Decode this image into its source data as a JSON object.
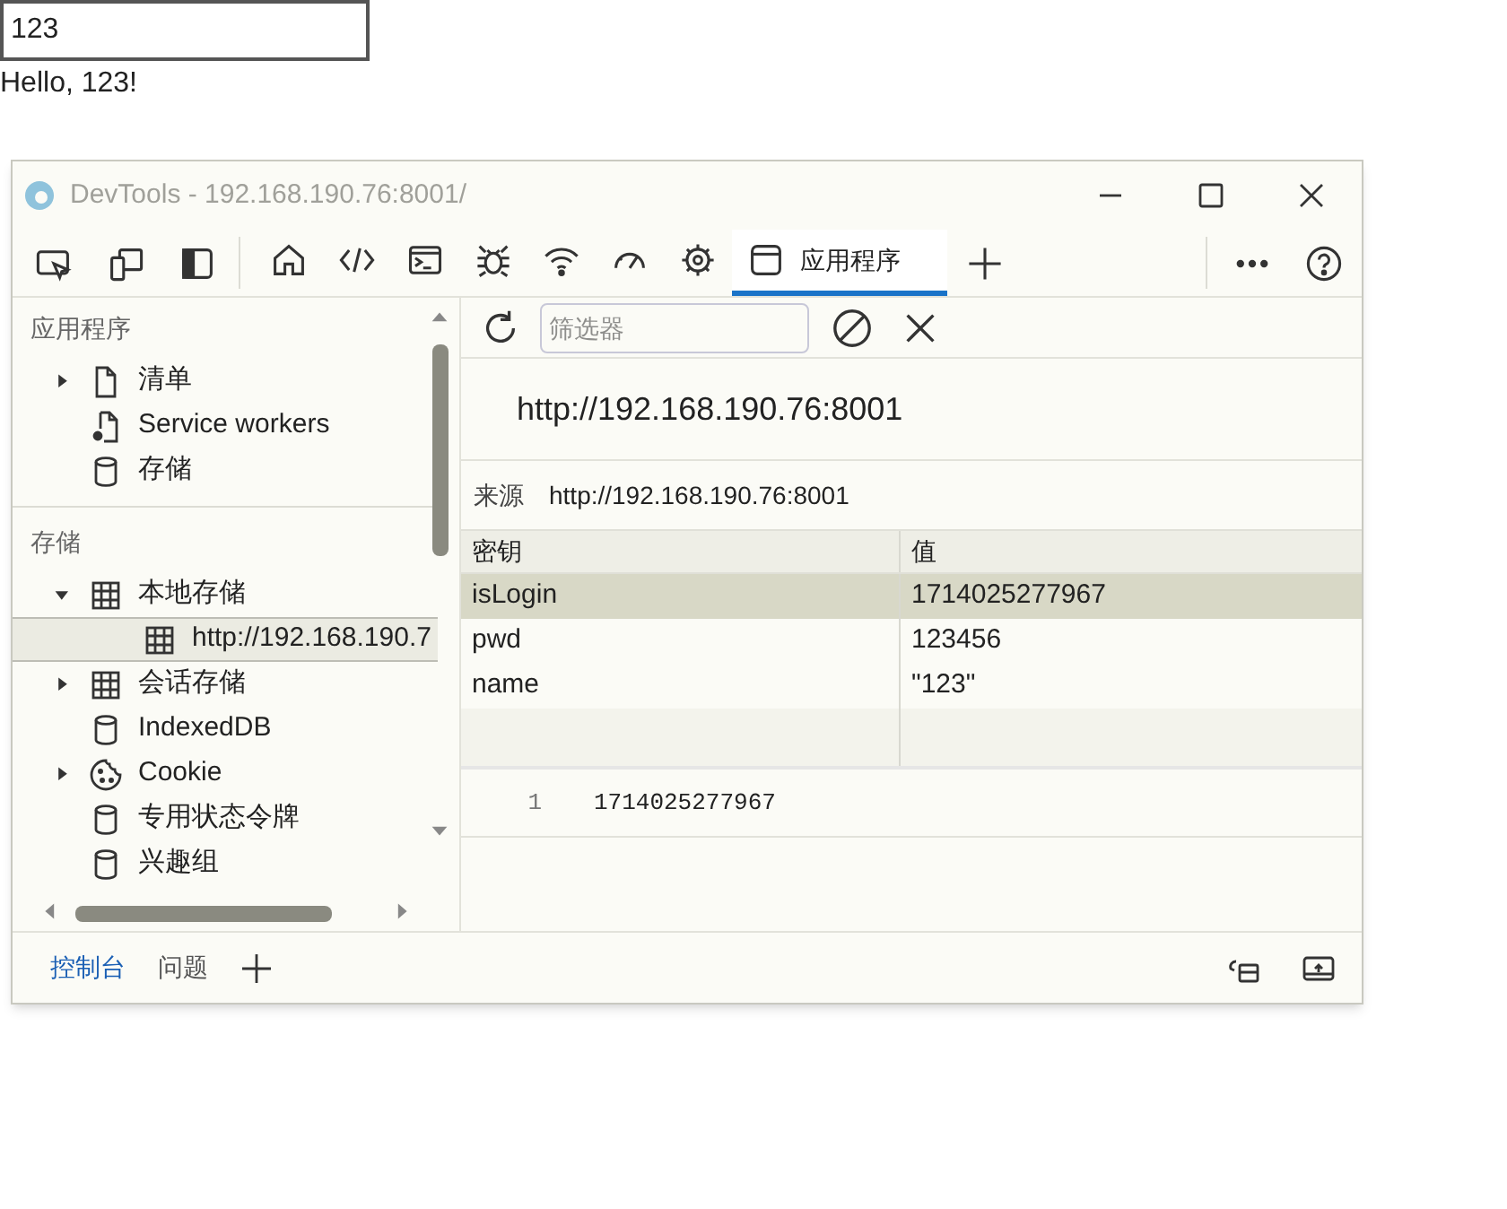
{
  "page": {
    "input_value": "123",
    "greeting": "Hello, 123!"
  },
  "window": {
    "title": "DevTools - 192.168.190.76:8001/"
  },
  "toolbar": {
    "left_tools": [
      {
        "kind": "inspect"
      },
      {
        "kind": "device"
      },
      {
        "kind": "dock"
      }
    ],
    "tabs": [
      {
        "kind": "home",
        "selected": false
      },
      {
        "kind": "code",
        "selected": false
      },
      {
        "kind": "console",
        "selected": false
      },
      {
        "kind": "bug",
        "selected": false
      },
      {
        "kind": "wifi",
        "selected": false
      },
      {
        "kind": "gauge",
        "selected": false
      },
      {
        "kind": "chip",
        "selected": false
      },
      {
        "kind": "app",
        "label": "应用程序",
        "selected": true
      }
    ],
    "right_tools": [
      {
        "kind": "more"
      },
      {
        "kind": "help"
      }
    ]
  },
  "sidebar": {
    "sections": [
      {
        "title": "应用程序",
        "items": [
          {
            "label": "清单",
            "kind": "file",
            "expanded": false
          },
          {
            "label": "Service workers",
            "kind": "file-gear"
          },
          {
            "label": "存储",
            "kind": "cylinder"
          }
        ]
      },
      {
        "title": "存储",
        "items": [
          {
            "label": "本地存储",
            "kind": "grid",
            "expanded": true,
            "children": [
              {
                "label": "http://192.168.190.7",
                "kind": "grid",
                "selected": true
              }
            ]
          },
          {
            "label": "会话存储",
            "kind": "grid",
            "expanded": false
          },
          {
            "label": "IndexedDB",
            "kind": "cylinder"
          },
          {
            "label": "Cookie",
            "kind": "cookie",
            "expanded": false
          },
          {
            "label": "专用状态令牌",
            "kind": "cylinder"
          },
          {
            "label": "兴趣组",
            "kind": "cylinder"
          }
        ]
      }
    ]
  },
  "main": {
    "filter": {
      "placeholder": "筛选器"
    },
    "heading": "http://192.168.190.76:8001",
    "origin": {
      "label": "来源",
      "value": "http://192.168.190.76:8001"
    },
    "table": {
      "columns": [
        "密钥",
        "值"
      ],
      "rows": [
        {
          "key": "isLogin",
          "value": "1714025277967",
          "selected": true
        },
        {
          "key": "pwd",
          "value": "123456",
          "selected": false
        },
        {
          "key": "name",
          "value": "\"123\"",
          "selected": false
        }
      ]
    },
    "preview": {
      "line_number": "1",
      "text": "1714025277967"
    }
  },
  "drawer": {
    "tabs": [
      {
        "label": "控制台",
        "selected": true
      },
      {
        "label": "问题",
        "selected": false
      }
    ]
  }
}
